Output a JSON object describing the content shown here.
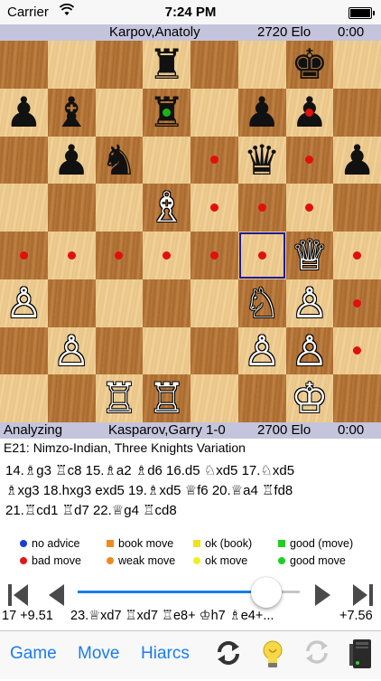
{
  "status_bar": {
    "carrier": "Carrier",
    "time": "7:24 PM"
  },
  "top_player": {
    "name": "Karpov,Anatoly",
    "elo": "2720 Elo",
    "clock": "0:00"
  },
  "bottom_player": {
    "status": "Analyzing",
    "name": "Kasparov,Garry 1-0",
    "elo": "2700 Elo",
    "clock": "0:00"
  },
  "board": {
    "selected_square": "f4",
    "pieces": [
      {
        "square": "d8",
        "glyph": "♜",
        "color": "b",
        "name": "black-rook-icon"
      },
      {
        "square": "g8",
        "glyph": "♚",
        "color": "b",
        "name": "black-king-icon"
      },
      {
        "square": "a7",
        "glyph": "♟",
        "color": "b",
        "name": "black-pawn-icon"
      },
      {
        "square": "b7",
        "glyph": "♝",
        "color": "b",
        "name": "black-bishop-icon"
      },
      {
        "square": "d7",
        "glyph": "♜",
        "color": "b",
        "name": "black-rook-icon"
      },
      {
        "square": "f7",
        "glyph": "♟",
        "color": "b",
        "name": "black-pawn-icon"
      },
      {
        "square": "g7",
        "glyph": "♟",
        "color": "b",
        "name": "black-pawn-icon"
      },
      {
        "square": "b6",
        "glyph": "♟",
        "color": "b",
        "name": "black-pawn-icon"
      },
      {
        "square": "c6",
        "glyph": "♞",
        "color": "b",
        "name": "black-knight-icon"
      },
      {
        "square": "f6",
        "glyph": "♛",
        "color": "b",
        "name": "black-queen-icon"
      },
      {
        "square": "h6",
        "glyph": "♟",
        "color": "b",
        "name": "black-pawn-icon"
      },
      {
        "square": "d5",
        "glyph": "♗",
        "color": "w",
        "name": "white-bishop-icon"
      },
      {
        "square": "g4",
        "glyph": "♕",
        "color": "w",
        "name": "white-queen-icon"
      },
      {
        "square": "a3",
        "glyph": "♙",
        "color": "w",
        "name": "white-pawn-icon"
      },
      {
        "square": "f3",
        "glyph": "♘",
        "color": "w",
        "name": "white-knight-icon"
      },
      {
        "square": "g3",
        "glyph": "♙",
        "color": "w",
        "name": "white-pawn-icon"
      },
      {
        "square": "b2",
        "glyph": "♙",
        "color": "w",
        "name": "white-pawn-icon"
      },
      {
        "square": "f2",
        "glyph": "♙",
        "color": "w",
        "name": "white-pawn-icon"
      },
      {
        "square": "g2",
        "glyph": "♙",
        "color": "w",
        "name": "white-pawn-icon"
      },
      {
        "square": "c1",
        "glyph": "♖",
        "color": "w",
        "name": "white-rook-icon"
      },
      {
        "square": "d1",
        "glyph": "♖",
        "color": "w",
        "name": "white-rook-icon"
      },
      {
        "square": "g1",
        "glyph": "♔",
        "color": "w",
        "name": "white-king-icon"
      }
    ],
    "red_dots": [
      "g7",
      "e6",
      "g6",
      "e5",
      "f5",
      "g5",
      "a4",
      "b4",
      "c4",
      "d4",
      "e4",
      "f4",
      "h4",
      "h3",
      "h2"
    ],
    "green_dots": [
      "d7"
    ]
  },
  "opening": "E21: Nimzo-Indian, Three Knights Variation",
  "moves": [
    "14.♗g3 ♖c8 15.♗a2 ♗d6 16.d5 ♘xd5 17.♘xd5",
    "♗xg3 18.hxg3 exd5 19.♗xd5 ♕f6 20.♕a4 ♖fd8",
    "21.♖cd1 ♖d7 22.♕g4 ♖cd8"
  ],
  "legend": [
    {
      "label": "no advice",
      "color": "#1c3fd6",
      "shape": "round"
    },
    {
      "label": "book move",
      "color": "#f08a20",
      "shape": "square"
    },
    {
      "label": "ok (book)",
      "color": "#f0e020",
      "shape": "square"
    },
    {
      "label": "good (move)",
      "color": "#20d020",
      "shape": "square"
    },
    {
      "label": "bad move",
      "color": "#e01818",
      "shape": "round"
    },
    {
      "label": "weak move",
      "color": "#f08a20",
      "shape": "round"
    },
    {
      "label": "ok move",
      "color": "#f0f020",
      "shape": "round"
    },
    {
      "label": "good move",
      "color": "#20d020",
      "shape": "round"
    }
  ],
  "navigation": {
    "slider_value": 0.85
  },
  "engine_line": {
    "depth_eval": "17 +9.51",
    "pv": "23.♕xd7 ♖xd7 ♖e8+ ♔h7 ♗e4+...",
    "eval": "+7.56"
  },
  "toolbar": {
    "game": "Game",
    "move": "Move",
    "hiarcs": "Hiarcs"
  },
  "colors": {
    "accent": "#1a7cf0",
    "player_bar": "#c4c4dc"
  }
}
